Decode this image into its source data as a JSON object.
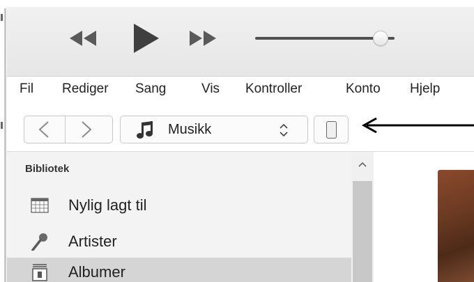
{
  "player": {
    "volume_level": 0.9
  },
  "menubar": {
    "items": [
      "Fil",
      "Rediger",
      "Sang",
      "Vis",
      "Kontroller",
      "Konto",
      "Hjelp"
    ]
  },
  "navbar": {
    "media_type": "Musikk"
  },
  "sidebar": {
    "heading": "Bibliotek",
    "items": [
      {
        "label": "Nylig lagt til",
        "icon": "grid-icon"
      },
      {
        "label": "Artister",
        "icon": "microphone-icon"
      },
      {
        "label": "Albumer",
        "icon": "album-icon",
        "selected": true
      }
    ]
  },
  "colors": {
    "selected_row": "#d5d5d5",
    "sidebar_bg": "#f3f3f3",
    "arrow": "#000000"
  }
}
